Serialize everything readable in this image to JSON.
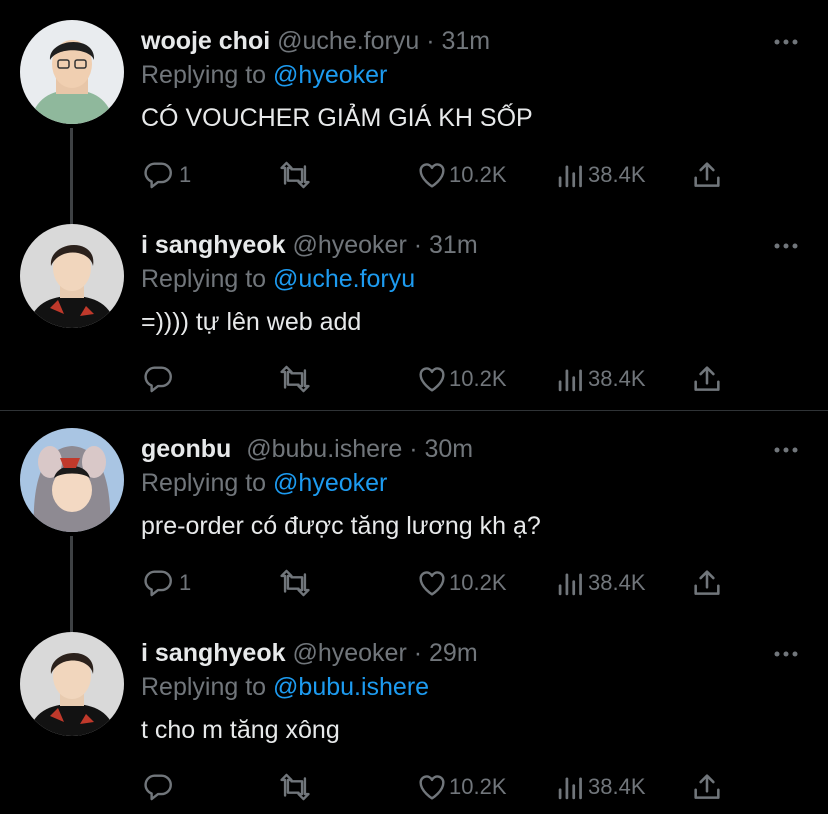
{
  "tweets": [
    {
      "name": "wooje choi",
      "handle": "@uche.foryu",
      "separator": "·",
      "time": "31m",
      "replying_label": "Replying to",
      "replying_to": "@hyeoker",
      "text": "CÓ VOUCHER GIẢM GIÁ KH SỐP",
      "reply_count": "1",
      "likes": "10.2K",
      "views": "38.4K"
    },
    {
      "name": "i sanghyeok",
      "handle": "@hyeoker",
      "separator": "·",
      "time": "31m",
      "replying_label": "Replying to",
      "replying_to": "@uche.foryu",
      "text": "=)))) tự lên web add",
      "reply_count": "",
      "likes": "10.2K",
      "views": "38.4K"
    },
    {
      "name": "geonbu",
      "handle": "@bubu.ishere",
      "separator": "·",
      "time": "30m",
      "replying_label": "Replying to",
      "replying_to": "@hyeoker",
      "text": "pre-order có được tăng lương kh ạ?",
      "reply_count": "1",
      "likes": "10.2K",
      "views": "38.4K"
    },
    {
      "name": "i sanghyeok",
      "handle": "@hyeoker",
      "separator": "·",
      "time": "29m",
      "replying_label": "Replying to",
      "replying_to": "@bubu.ishere",
      "text": "t cho m tăng xông",
      "reply_count": "",
      "likes": "10.2K",
      "views": "38.4K"
    }
  ],
  "icons": {
    "reply": "reply-icon",
    "retweet": "retweet-icon",
    "like": "heart-icon",
    "views": "views-icon",
    "share": "share-icon",
    "more": "more-icon"
  },
  "colors": {
    "background": "#000000",
    "text": "#e7e9ea",
    "muted": "#71767b",
    "link": "#1d9bf0",
    "line": "#3e4144"
  }
}
